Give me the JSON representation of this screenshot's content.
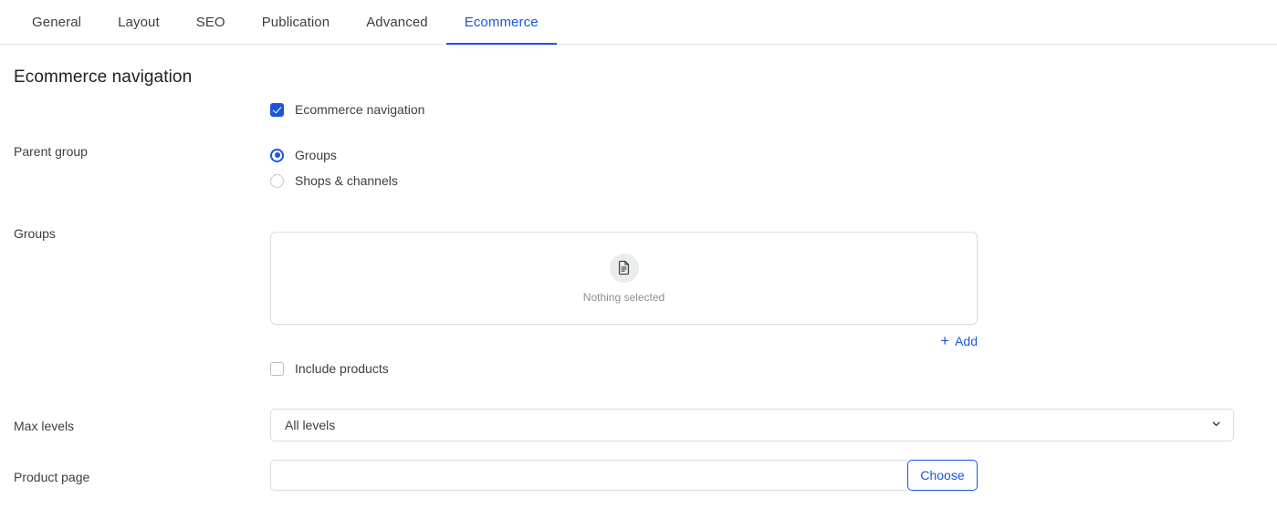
{
  "tabs": [
    {
      "label": "General",
      "active": false
    },
    {
      "label": "Layout",
      "active": false
    },
    {
      "label": "SEO",
      "active": false
    },
    {
      "label": "Publication",
      "active": false
    },
    {
      "label": "Advanced",
      "active": false
    },
    {
      "label": "Ecommerce",
      "active": true
    }
  ],
  "page": {
    "title": "Ecommerce navigation"
  },
  "form": {
    "enable_toggle": {
      "label": "Ecommerce navigation",
      "checked": true
    },
    "parent_group": {
      "label": "Parent group",
      "options": [
        {
          "label": "Groups",
          "selected": true
        },
        {
          "label": "Shops & channels",
          "selected": false
        }
      ]
    },
    "groups": {
      "label": "Groups",
      "empty_state_icon": "document-icon",
      "empty_state_text": "Nothing selected",
      "add_label": "Add",
      "add_icon": "plus-icon"
    },
    "include_products": {
      "label": "Include products",
      "checked": false
    },
    "max_levels": {
      "label": "Max levels",
      "value": "All levels",
      "icon": "chevron-down-icon"
    },
    "product_page": {
      "label": "Product page",
      "value": "",
      "placeholder": "",
      "choose_label": "Choose"
    }
  },
  "colors": {
    "accent": "#1a56db",
    "text": "#3c4043",
    "muted": "#8a8f94",
    "border": "#dadce0"
  }
}
